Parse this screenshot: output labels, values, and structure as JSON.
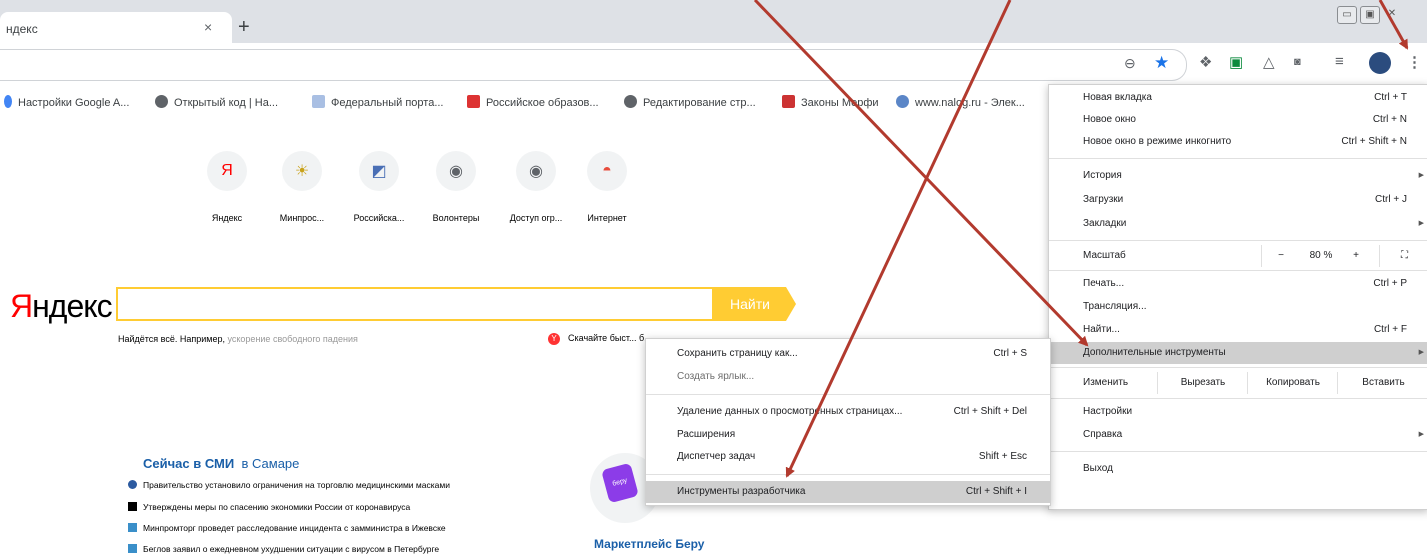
{
  "tab": {
    "title": "ндекс",
    "close": "×",
    "new_tab": "+"
  },
  "window_controls": [
    "▭",
    "▣",
    "✕"
  ],
  "toolbar_icons": [
    "zoom-icon",
    "star-icon",
    "extension-icon",
    "extension-icon",
    "bell-icon",
    "extension-icon",
    "media-icon",
    "avatar",
    "menu-icon"
  ],
  "bookmarks": [
    {
      "label": "Настройки Google A...",
      "color": "#4285f4"
    },
    {
      "label": "Открытый код | На...",
      "color": "#3c4043"
    },
    {
      "label": "Федеральный порта...",
      "color": "#6b8fc9"
    },
    {
      "label": "Российское образов...",
      "color": "#d33"
    },
    {
      "label": "Редактирование стр...",
      "color": "#3c4043"
    },
    {
      "label": "Законы Мерфи",
      "color": "#c33"
    },
    {
      "label": "www.nalog.ru - Элек...",
      "color": "#5b86c7"
    }
  ],
  "shortcuts": [
    {
      "label": "Яндекс",
      "glyph": "Я"
    },
    {
      "label": "Минпрос...",
      "glyph": "☀"
    },
    {
      "label": "Российска...",
      "glyph": "◩"
    },
    {
      "label": "Волонтеры",
      "glyph": "◉"
    },
    {
      "label": "Доступ огр...",
      "glyph": "◉"
    },
    {
      "label": "Интернет",
      "glyph": "◓"
    }
  ],
  "yandex": {
    "logo_first": "Я",
    "logo_rest": "ндекс",
    "search_button": "Найти",
    "hint_prefix": "Найдётся всё. Например, ",
    "hint_example": "ускорение свободного падения",
    "promo": "Скачайте быст... б..."
  },
  "news": {
    "heading": "Сейчас в СМИ",
    "city": "в Самаре",
    "items": [
      "Правительство установило ограничения на торговлю медицинскими масками",
      "Утверждены меры по спасению экономики России от коронавируса",
      "Минпромторг проведет расследование инцидента с замминистра в Ижевске",
      "Беглов заявил о ежедневном ухудшении ситуации с вирусом в Петербурге"
    ]
  },
  "beru": {
    "logo": "беру",
    "title": "Маркетплейс Беру"
  },
  "menu": {
    "new_tab": "Новая вкладка",
    "new_tab_key": "Ctrl + T",
    "new_window": "Новое окно",
    "new_window_key": "Ctrl + N",
    "incognito": "Новое окно в режиме инкогнито",
    "incognito_key": "Ctrl + Shift + N",
    "history": "История",
    "downloads": "Загрузки",
    "downloads_key": "Ctrl + J",
    "bookmarks": "Закладки",
    "zoom_label": "Масштаб",
    "zoom_minus": "−",
    "zoom_value": "80 %",
    "zoom_plus": "+",
    "fullscreen": "⛶",
    "print": "Печать...",
    "print_key": "Ctrl + P",
    "cast": "Трансляция...",
    "find": "Найти...",
    "find_key": "Ctrl + F",
    "more_tools": "Дополнительные инструменты",
    "edit": "Изменить",
    "cut": "Вырезать",
    "copy": "Копировать",
    "paste": "Вставить",
    "settings": "Настройки",
    "help": "Справка",
    "exit": "Выход"
  },
  "submenu": {
    "save_page": "Сохранить страницу как...",
    "save_page_key": "Ctrl + S",
    "create_shortcut": "Создать ярлык...",
    "clear_data": "Удаление данных о просмотренных страницах...",
    "clear_data_key": "Ctrl + Shift + Del",
    "extensions": "Расширения",
    "task_manager": "Диспетчер задач",
    "task_manager_key": "Shift + Esc",
    "dev_tools": "Инструменты разработчика",
    "dev_tools_key": "Ctrl + Shift + I"
  },
  "annotation_color": "#b23a2e"
}
